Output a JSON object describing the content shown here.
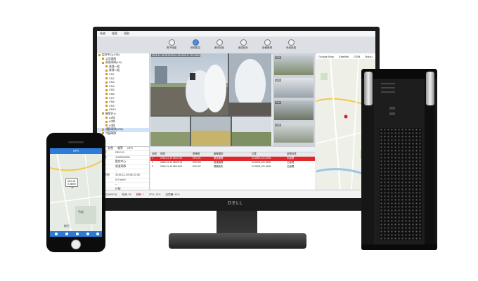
{
  "screen": {
    "menu": [
      "系統",
      "搜索",
      "幫助"
    ],
    "toolbar": [
      {
        "label": "電子地圖",
        "active": false
      },
      {
        "label": "即時監控",
        "active": true
      },
      {
        "label": "歷史回放",
        "active": false
      },
      {
        "label": "報表統計",
        "active": false
      },
      {
        "label": "設備管理",
        "active": false
      },
      {
        "label": "系統設置",
        "active": false
      }
    ],
    "tree": [
      "監控中心(1/56)",
      "公司車隊",
      "貨運車隊(1/5)",
      "貨運一組",
      "貨運二組",
      "CN1",
      "CN2",
      "CN3",
      "CN4",
      "CN5",
      "CN6",
      "CN7",
      "CN8",
      "CN9",
      "CN10",
      "機場巴士",
      "A1線",
      "A2線",
      "A3線",
      "通勤車隊(0/30)",
      "冷鏈車隊"
    ],
    "selected_tree_index": 19,
    "info_tabs": [
      "車輛",
      "狀態",
      "報警",
      "GPS"
    ],
    "info": [
      {
        "k": "車牌號",
        "v": "DEV-01"
      },
      {
        "k": "設備號",
        "v": "1100000000"
      },
      {
        "k": "公司",
        "v": "監控中心"
      },
      {
        "k": "車隊",
        "v": "貨運車隊"
      },
      {
        "k": "司機",
        "v": "--"
      },
      {
        "k": "GPS時間",
        "v": "2016-11-19 08:22:30"
      },
      {
        "k": "速度",
        "v": "0.0 km/h"
      },
      {
        "k": "位置",
        "v": "--"
      },
      {
        "k": "狀態",
        "v": "在線"
      },
      {
        "k": "網絡",
        "v": "4G"
      }
    ],
    "video_label": "2016-11-19  08:22:30   N: 24.0000  E: 121.0000",
    "thumb_labels": [
      "CH2",
      "CH3",
      "CH4",
      "CH5"
    ],
    "map_tabs": [
      "Google Map",
      "Satellite",
      "OSM",
      "Baidu"
    ],
    "table_tabs": [
      "即時報警",
      "報警處理",
      "狀態",
      "事件",
      "提醒"
    ],
    "table_headers": [
      "序號",
      "時間",
      "車牌號",
      "報警類型",
      "位置",
      "處理狀態"
    ],
    "table_rows": [
      {
        "no": "1",
        "time": "2016-11-19 08:22:30",
        "plate": "DEV-01",
        "type": "緊急報警",
        "loc": "24.0000,121.0000",
        "state": "未處理",
        "alert": true
      },
      {
        "no": "2",
        "time": "2016-11-19 08:20:14",
        "plate": "DEV-03",
        "type": "超速報警",
        "loc": "24.0100,121.0200",
        "state": "已處理",
        "alert": false
      },
      {
        "no": "3",
        "time": "2016-11-19 08:18:02",
        "plate": "DEV-07",
        "type": "視頻丟失",
        "loc": "24.0300,121.0400",
        "state": "已處理",
        "alert": false
      }
    ],
    "status": [
      "1.0.1.0(180813)",
      "在線: 56",
      "報警: 1",
      "CPU: 12%",
      "記憶體: 41%"
    ],
    "status_warn": "報警: 1",
    "monitor_brand": "DELL"
  },
  "phone": {
    "app_title": "GPS",
    "callout_line1": "DEV-01",
    "callout_line2": "0.0km/h",
    "map_label1": "竹北",
    "map_label2": "新竹"
  },
  "colors": {
    "accent": "#2d7bd6",
    "alert": "#e3262a",
    "tree_folder": "#c99a2e"
  }
}
